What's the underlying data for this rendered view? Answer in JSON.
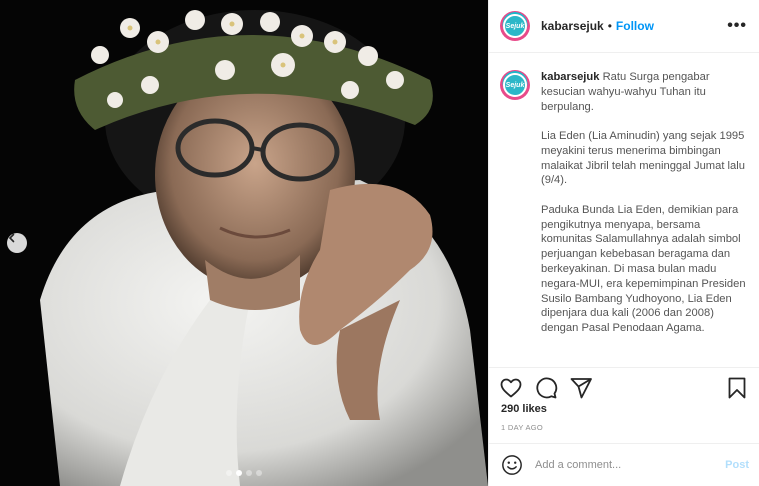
{
  "post": {
    "username": "kabarsejuk",
    "avatar_text": "Sejuk",
    "follow_label": "Follow",
    "more_label": "•••",
    "separator": "•"
  },
  "caption": {
    "username": "kabarsejuk",
    "lead": "Ratu Surga pengabar kesucian wahyu-wahyu Tuhan itu berpulang.",
    "p1": "Lia Eden (Lia Aminudin) yang sejak 1995 meyakini terus menerima bimbingan malaikat Jibril telah meninggal Jumat lalu (9/4).",
    "p2": "Paduka Bunda Lia Eden, demikian para pengikutnya menyapa, bersama komunitas Salamullahnya adalah simbol perjuangan kebebasan beragama dan berkeyakinan. Di masa bulan madu negara-MUI, era kepemimpinan Presiden Susilo Bambang Yudhoyono, Lia Eden dipenjara dua kali (2006 dan 2008) dengan Pasal Penodaan Agama."
  },
  "stats": {
    "likes": "290 likes",
    "time": "1 DAY AGO"
  },
  "comment": {
    "placeholder": "Add a comment...",
    "post_label": "Post"
  },
  "icons": {
    "like": "heart-icon",
    "comment": "comment-icon",
    "share": "share-icon",
    "save": "bookmark-icon",
    "emoji": "emoji-icon",
    "prev": "chevron-left-icon"
  },
  "colors": {
    "accent": "#0095f6",
    "post_disabled": "#b2dffc",
    "muted": "#8e8e8e"
  },
  "carousel": {
    "slide_count": 4,
    "active_index": 2
  }
}
